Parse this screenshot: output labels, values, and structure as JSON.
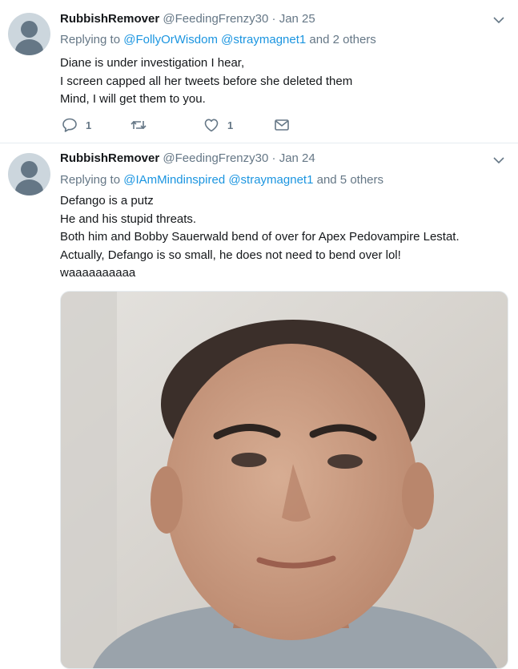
{
  "tweets": [
    {
      "display_name": "RubbishRemover",
      "handle": "@FeedingFrenzy30",
      "separator": "·",
      "date": "Jan 25",
      "replying_prefix": "Replying to",
      "mention_1": "@FollyOrWisdom",
      "mention_2": "@straymagnet1",
      "replying_suffix": "and 2 others",
      "lines": [
        "Diane is under investigation I hear,",
        "I screen capped all her tweets before she deleted them",
        "Mind, I will get them to you."
      ],
      "reply_count": "1",
      "like_count": "1"
    },
    {
      "display_name": "RubbishRemover",
      "handle": "@FeedingFrenzy30",
      "separator": "·",
      "date": "Jan 24",
      "replying_prefix": "Replying to",
      "mention_1": "@IAmMindinspired",
      "mention_2": "@straymagnet1",
      "replying_suffix": "and 5 others",
      "lines": [
        "Defango is a putz",
        "He and his stupid threats.",
        "Both him and Bobby Sauerwald bend of over for Apex Pedovampire Lestat.",
        "Actually, Defango is so small, he does not need to bend over lol!",
        "waaaaaaaaaa"
      ]
    }
  ],
  "icons": {
    "caret": "chevron-down-icon",
    "reply": "reply-icon",
    "retweet": "retweet-icon",
    "like": "heart-icon",
    "message": "envelope-icon",
    "avatar": "default-avatar-icon"
  },
  "colors": {
    "link": "#1b95e0",
    "secondary_text": "#657786",
    "primary_text": "#14171a",
    "divider": "#e6ecf0"
  }
}
